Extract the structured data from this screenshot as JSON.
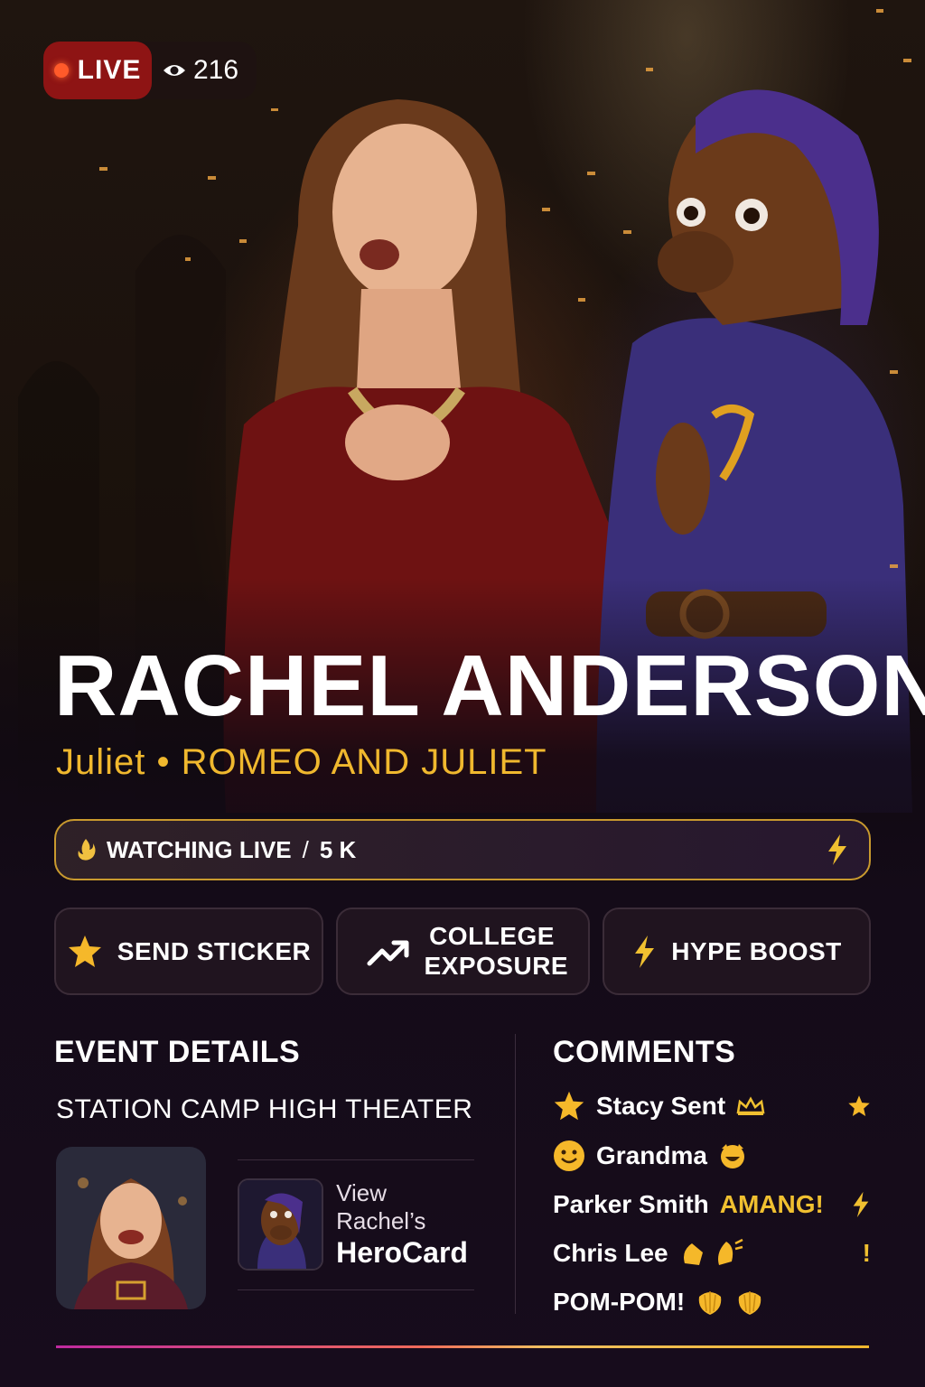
{
  "live": {
    "label": "LIVE",
    "viewer_count": "216"
  },
  "performer": {
    "name": "RACHEL ANDERSON",
    "role_line": "Juliet • ROMEO AND JULIET"
  },
  "watching": {
    "label": "WATCHING LIVE",
    "separator": "/",
    "count": "5 K"
  },
  "actions": [
    {
      "label": "SEND STICKER",
      "icon": "star-icon"
    },
    {
      "label": "COLLEGE EXPOSURE",
      "icon": "trending-up-icon"
    },
    {
      "label": "HYPE BOOST",
      "icon": "lightning-icon"
    }
  ],
  "event": {
    "title": "EVENT DETAILS",
    "venue": "STATION CAMP HIGH THEATER",
    "herocard_line1": "View Rachel’s",
    "herocard_line2": "HeroCard"
  },
  "comments": {
    "title": "COMMENTS",
    "items": [
      {
        "text": "Stacy Sent",
        "lead_icon": "star-icon",
        "trail_icon": "crown-icon",
        "end_icon": "star-icon"
      },
      {
        "text": "Grandma",
        "lead_icon": "smile-icon",
        "trail_icon": "grin-face-icon"
      },
      {
        "text": "Parker Smith",
        "extra": "AMANG!",
        "end_icon": "lightning-icon"
      },
      {
        "text": "Chris Lee",
        "trail_icon": "clap-icon",
        "end": "!"
      },
      {
        "text": "POM-POM!",
        "trail_icon": "pom-pom-icon"
      }
    ]
  },
  "colors": {
    "accent_gold": "#f0b82e",
    "live_red": "#8e1414",
    "background": "#140b18"
  }
}
